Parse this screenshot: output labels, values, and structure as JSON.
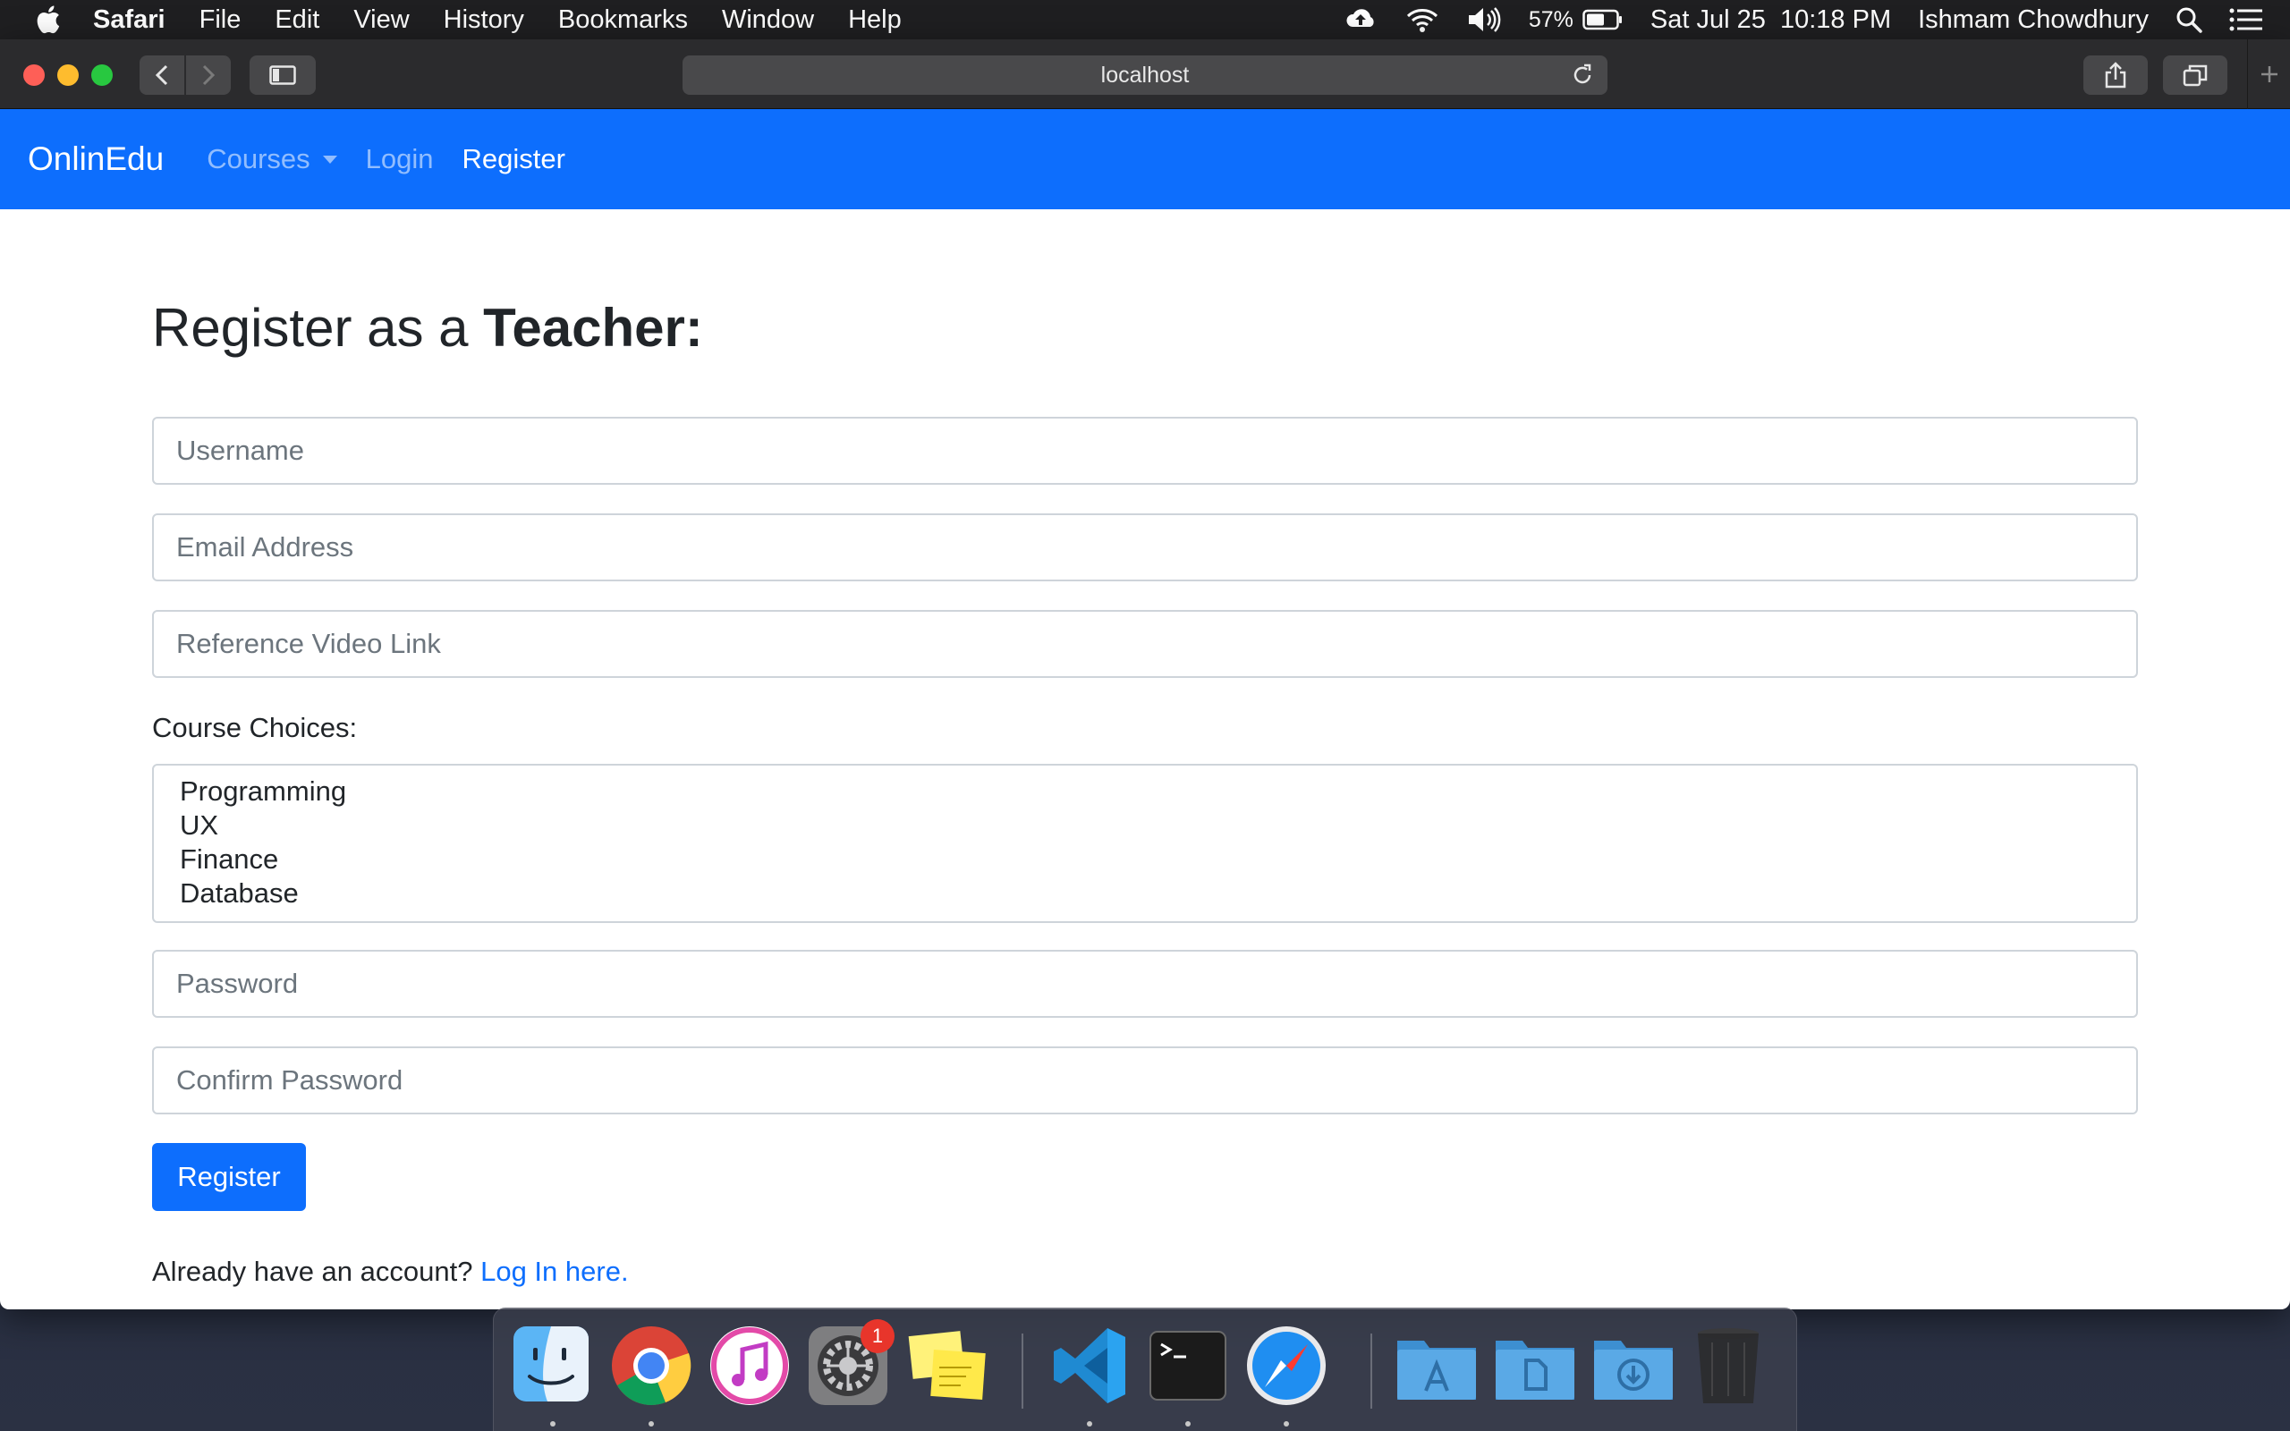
{
  "menubar": {
    "app_name": "Safari",
    "items": [
      "File",
      "Edit",
      "View",
      "History",
      "Bookmarks",
      "Window",
      "Help"
    ],
    "battery": "57%",
    "datetime": "Sat Jul 25  10:18 PM",
    "user": "Ishmam Chowdhury"
  },
  "browser": {
    "url": "localhost"
  },
  "navbar": {
    "brand": "OnlinEdu",
    "courses": "Courses",
    "login": "Login",
    "register": "Register"
  },
  "form": {
    "title_prefix": "Register as a ",
    "title_bold": "Teacher:",
    "username_placeholder": "Username",
    "email_placeholder": "Email Address",
    "video_placeholder": "Reference Video Link",
    "course_label": "Course Choices:",
    "course_options": [
      "Programming",
      "UX",
      "Finance",
      "Database"
    ],
    "password_placeholder": "Password",
    "confirm_placeholder": "Confirm Password",
    "submit_label": "Register",
    "footer_text": "Already have an account? ",
    "login_link": "Log In here."
  },
  "dock": {
    "items": [
      "finder-icon",
      "chrome-icon",
      "itunes-icon",
      "system-preferences-icon",
      "stickies-icon",
      "vscode-icon",
      "terminal-icon",
      "safari-icon",
      "applications-folder-icon",
      "documents-folder-icon",
      "downloads-folder-icon",
      "trash-icon"
    ],
    "notification_badge": "1"
  },
  "colors": {
    "primary": "#0d6efd",
    "menubar": "#1f1f21",
    "toolbar": "#2b2b2d"
  }
}
